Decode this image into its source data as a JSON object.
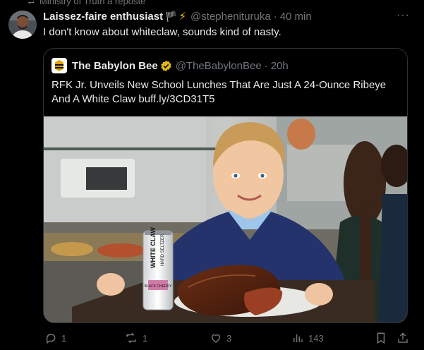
{
  "repost_notice": "Ministry of Truth a reposté",
  "post": {
    "display_name": "Laissez-faire enthusiast",
    "flag_emoji": "🏴",
    "bolt_emoji": "⚡",
    "handle": "@stephenituruka",
    "separator": "·",
    "time": "40 min",
    "more_label": "···",
    "text": "I don't know about whiteclaw, sounds kind of nasty."
  },
  "quote": {
    "name": "The Babylon Bee",
    "handle": "@TheBabylonBee",
    "separator": "·",
    "time": "20h",
    "text": "RFK Jr. Unveils New School Lunches That Are Just A 24-Ounce Ribeye And A White Claw buff.ly/3CD31T5",
    "can": {
      "brand": "WHITE CLAW",
      "subtitle": "HARD SELTZER",
      "flavor": "BLACK CHERRY"
    }
  },
  "actions": {
    "replies": "1",
    "reposts": "1",
    "likes": "3",
    "views": "143"
  },
  "colors": {
    "background": "#000000",
    "text": "#e7e9ea",
    "muted": "#71767b",
    "border": "#2f3336",
    "verified_gold": "#e2b719"
  }
}
